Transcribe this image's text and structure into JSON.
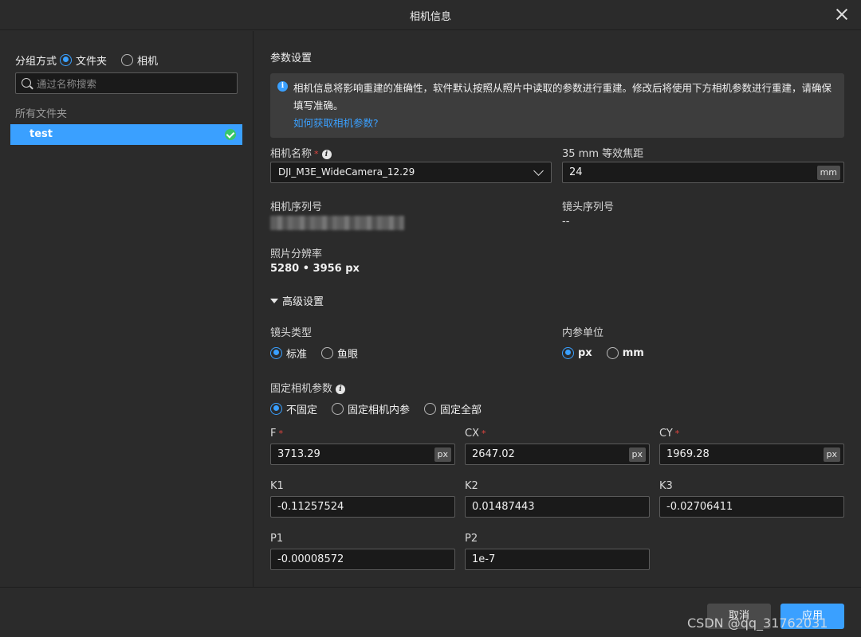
{
  "window": {
    "title": "相机信息"
  },
  "left": {
    "group_label": "分组方式",
    "group_options": [
      {
        "label": "文件夹",
        "selected": true
      },
      {
        "label": "相机",
        "selected": false
      }
    ],
    "search_placeholder": "通过名称搜索",
    "all_folders_label": "所有文件夹",
    "folders": [
      {
        "name": "test",
        "status": "ok"
      }
    ]
  },
  "params": {
    "section_title": "参数设置",
    "info": {
      "message": "相机信息将影响重建的准确性，软件默认按照从照片中读取的参数进行重建。修改后将使用下方相机参数进行重建，请确保填写准确。",
      "link": "如何获取相机参数?"
    },
    "camera_name_label": "相机名称",
    "camera_name_value": "DJI_M3E_WideCamera_12.29",
    "focal_label": "35 mm 等效焦距",
    "focal_value": "24",
    "focal_unit": "mm",
    "camera_serial_label": "相机序列号",
    "lens_serial_label": "镜头序列号",
    "lens_serial_value": "--",
    "resolution_label": "照片分辨率",
    "resolution_value": "5280 • 3956 px",
    "advanced_label": "高级设置",
    "lens_type_label": "镜头类型",
    "lens_type_options": [
      {
        "label": "标准",
        "selected": true
      },
      {
        "label": "鱼眼",
        "selected": false
      }
    ],
    "intrinsic_unit_label": "内参单位",
    "intrinsic_unit_options": [
      {
        "label": "px",
        "selected": true
      },
      {
        "label": "mm",
        "selected": false
      }
    ],
    "fix_label": "固定相机参数",
    "fix_options": [
      {
        "label": "不固定",
        "selected": true
      },
      {
        "label": "固定相机内参",
        "selected": false
      },
      {
        "label": "固定全部",
        "selected": false
      }
    ],
    "F": {
      "label": "F",
      "value": "3713.29",
      "unit": "px"
    },
    "CX": {
      "label": "CX",
      "value": "2647.02",
      "unit": "px"
    },
    "CY": {
      "label": "CY",
      "value": "1969.28",
      "unit": "px"
    },
    "K1": {
      "label": "K1",
      "value": "-0.11257524"
    },
    "K2": {
      "label": "K2",
      "value": "0.01487443"
    },
    "K3": {
      "label": "K3",
      "value": "-0.02706411"
    },
    "P1": {
      "label": "P1",
      "value": "-0.00008572"
    },
    "P2": {
      "label": "P2",
      "value": "1e-7"
    }
  },
  "footer": {
    "cancel_label": "取消",
    "apply_label": "应用",
    "watermark": "CSDN @qq_31762031"
  },
  "colors": {
    "accent": "#3aa0ff",
    "background": "#2b2b2b",
    "input_bg": "#1a1a1a",
    "required": "#e0453f",
    "success": "#37c76a"
  }
}
